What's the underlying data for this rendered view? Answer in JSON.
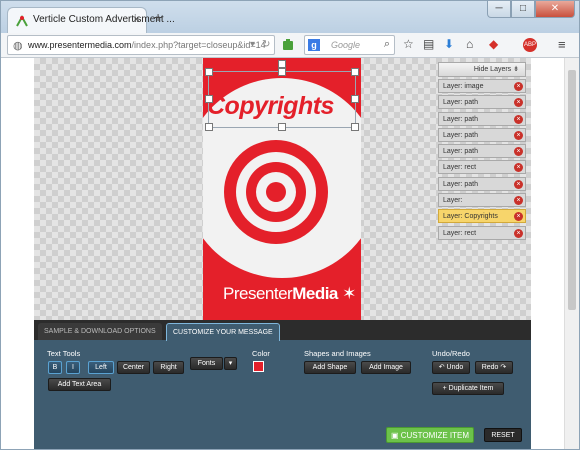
{
  "browser": {
    "tab_title": "Verticle Custom Advertisment ...",
    "tab_close": "×",
    "new_tab": "+",
    "window_buttons": [
      "─",
      "□",
      "✕"
    ],
    "url_domain": "www.presentermedia.com",
    "url_path": "/index.php?target=closeup&id=14",
    "search_engine_badge": "g",
    "search_placeholder": "Google",
    "icons": [
      "bookmark-star-icon",
      "clipboard-icon",
      "download-icon",
      "home-icon",
      "extension-icon",
      "abp-icon",
      "menu-icon"
    ]
  },
  "editor": {
    "banner": {
      "headline": "Copyrights",
      "brand_plain": "Presenter",
      "brand_bold": "Media",
      "bg_color": "#e4202a"
    },
    "layers": {
      "hide_label": "Hide Layers ⇟",
      "items": [
        {
          "label": "Layer: image",
          "active": false
        },
        {
          "label": "Layer: path",
          "active": false
        },
        {
          "label": "Layer: path",
          "active": false
        },
        {
          "label": "Layer: path",
          "active": false
        },
        {
          "label": "Layer: path",
          "active": false
        },
        {
          "label": "Layer: rect",
          "active": false
        },
        {
          "label": "Layer: path",
          "active": false
        },
        {
          "label": "Layer:",
          "active": false
        },
        {
          "label": "Layer: Copyrights",
          "active": true
        },
        {
          "label": "Layer: rect",
          "active": false
        }
      ],
      "remove_glyph": "×"
    },
    "panel": {
      "tabs": [
        "SAMPLE & DOWNLOAD OPTIONS",
        "CUSTOMIZE YOUR MESSAGE"
      ],
      "active_tab": "CUSTOMIZE YOUR MESSAGE",
      "text_tools_label": "Text Tools",
      "bold": "B",
      "italic": "I",
      "align_left": "Left",
      "align_center": "Center",
      "align_right": "Right",
      "add_text_area": "Add Text Area",
      "fonts": "Fonts",
      "fonts_caret": "▾",
      "color_label": "Color",
      "swatch_color": "#e4202a",
      "shapes_label": "Shapes and Images",
      "add_shape": "Add Shape",
      "add_image": "Add Image",
      "undo_label": "Undo/Redo",
      "undo": "↶ Undo",
      "redo": "Redo ↷",
      "duplicate": "+ Duplicate Item",
      "customize": "CUSTOMIZE ITEM",
      "reset": "RESET"
    }
  }
}
